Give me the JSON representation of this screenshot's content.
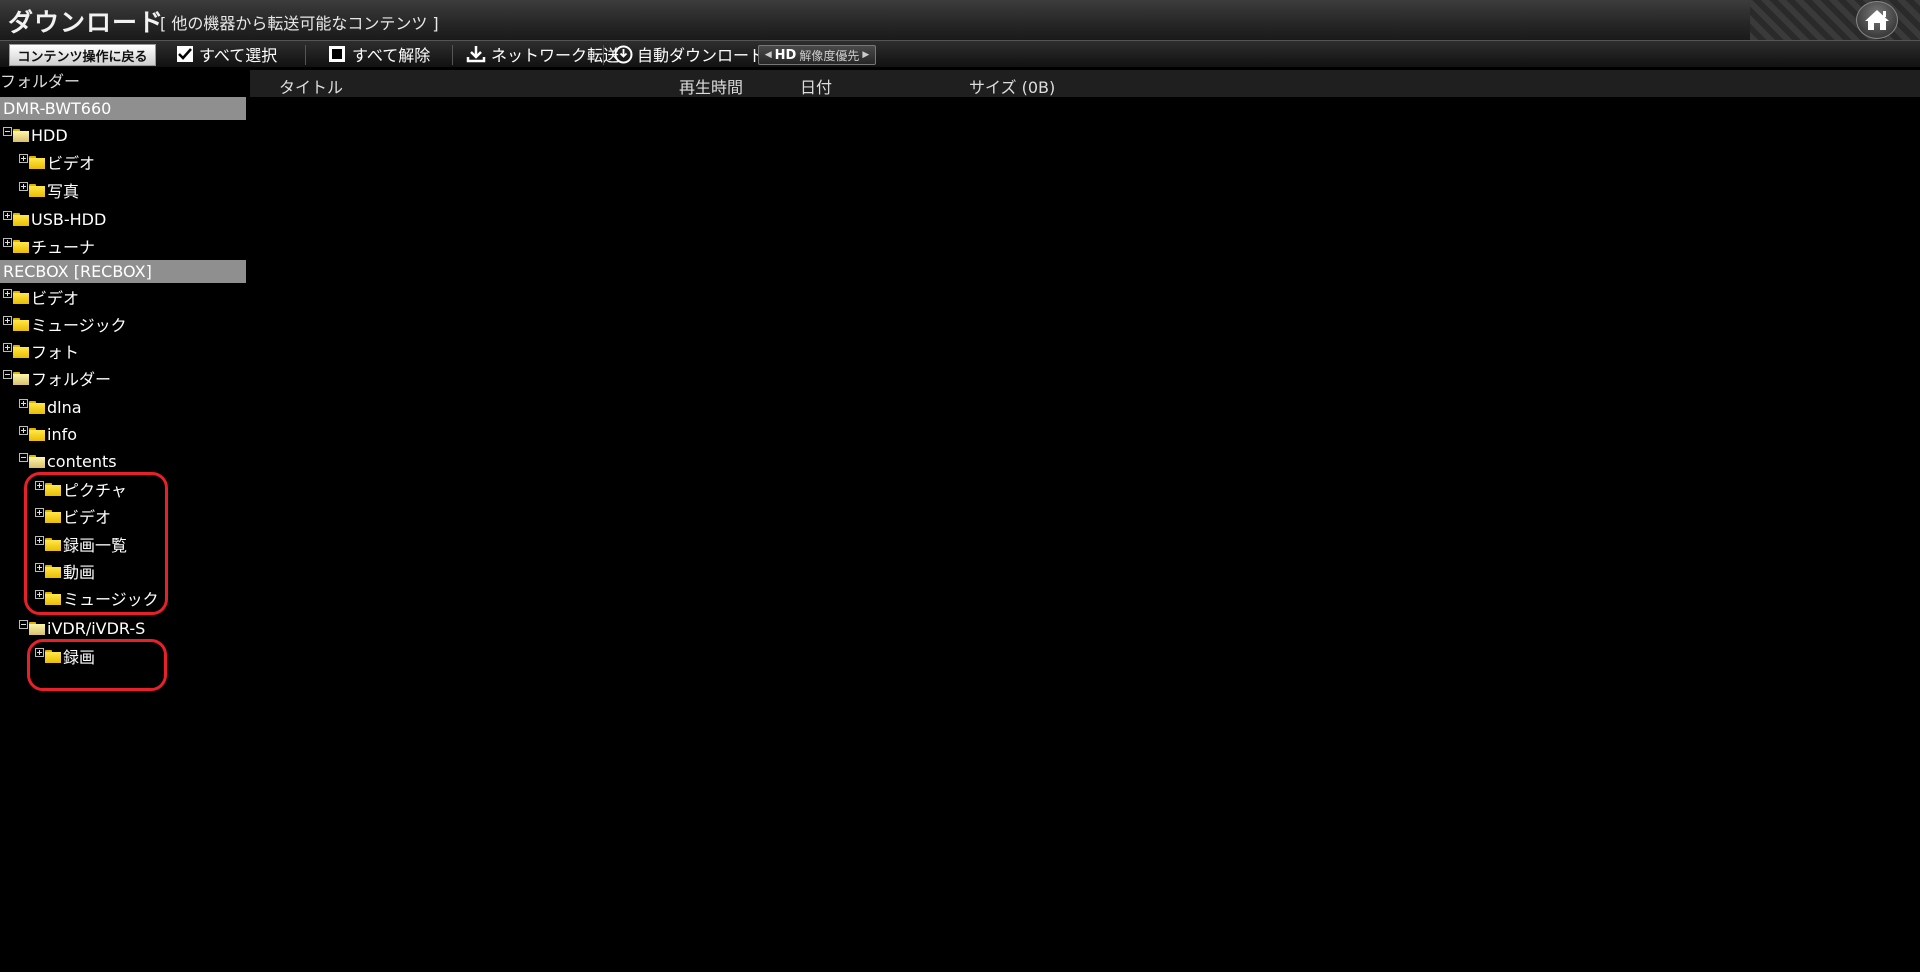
{
  "header": {
    "title": "ダウンロード",
    "subtitle": "[ 他の機器から転送可能なコンテンツ ]"
  },
  "toolbar": {
    "back_label": "コンテンツ操作に戻る",
    "select_all_label": "すべて選択",
    "deselect_all_label": "すべて解除",
    "network_transfer_label": "ネットワーク転送",
    "auto_download_label": "自動ダウンロード",
    "hd_label": "HD",
    "resolution_priority_label": "解像度優先"
  },
  "folder_panel": {
    "header": "フォルダー"
  },
  "list": {
    "columns": [
      "タイトル",
      "再生時間",
      "日付",
      "サイズ (0B)"
    ]
  },
  "tree": {
    "device1": "DMR-BWT660",
    "d1_hdd": "HDD",
    "d1_video": "ビデオ",
    "d1_photo": "写真",
    "d1_usbhdd": "USB-HDD",
    "d1_tuner": "チューナ",
    "device2": "RECBOX [RECBOX]",
    "d2_video": "ビデオ",
    "d2_music": "ミュージック",
    "d2_photo": "フォト",
    "d2_folder": "フォルダー",
    "d2_dlna": "dlna",
    "d2_info": "info",
    "d2_contents": "contents",
    "c_picture": "ピクチャ",
    "c_video": "ビデオ",
    "c_reclist": "録画一覧",
    "c_movie": "動画",
    "c_music": "ミュージック",
    "d2_ivdr": "iVDR/iVDR-S",
    "i_rec": "録画"
  },
  "colors": {
    "highlight": "#e8202a",
    "device_bar": "#8f8f8f",
    "folder": "#f5d300"
  }
}
